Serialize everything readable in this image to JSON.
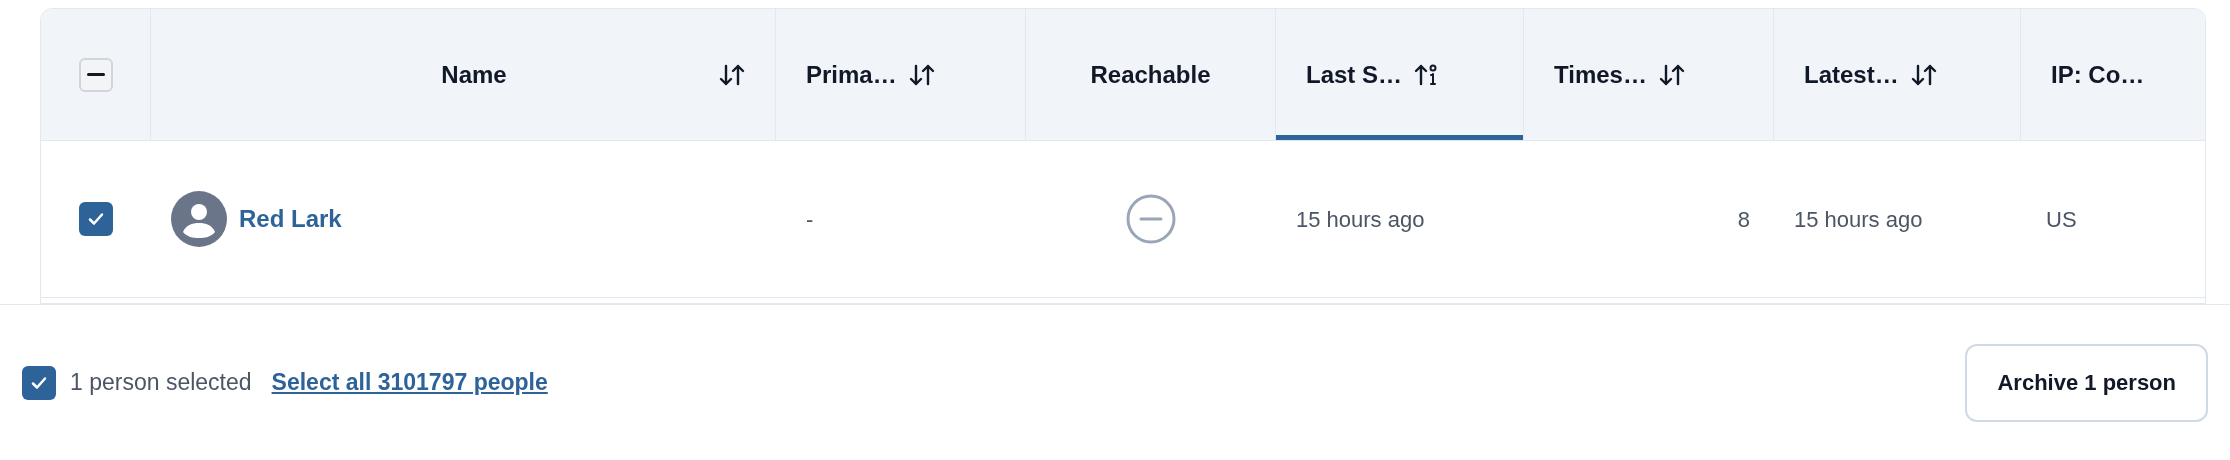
{
  "table": {
    "header_checkbox": {
      "indeterminate": true
    },
    "columns": [
      {
        "label": "Name",
        "kind": "sortable",
        "selected": false,
        "centered": true
      },
      {
        "label": "Prima…",
        "kind": "sortable",
        "selected": false,
        "centered": false
      },
      {
        "label": "Reachable",
        "kind": "plain",
        "selected": false,
        "centered": true
      },
      {
        "label": "Last S…",
        "kind": "sorted",
        "selected": true,
        "centered": false
      },
      {
        "label": "Times…",
        "kind": "sortable",
        "selected": false,
        "centered": false
      },
      {
        "label": "Latest…",
        "kind": "sortable",
        "selected": false,
        "centered": false
      },
      {
        "label": "IP: Co…",
        "kind": "plain",
        "selected": false,
        "centered": false
      }
    ],
    "rows": [
      {
        "checked": true,
        "name": "Red Lark",
        "primary": "-",
        "reachable": false,
        "last_seen": "15 hours ago",
        "times": "8",
        "latest": "15 hours ago",
        "ip_country": "US"
      }
    ]
  },
  "footer": {
    "checked": true,
    "count_text": "1 person selected",
    "select_all_link": "Select all 3101797 people",
    "archive_button": "Archive 1 person"
  }
}
